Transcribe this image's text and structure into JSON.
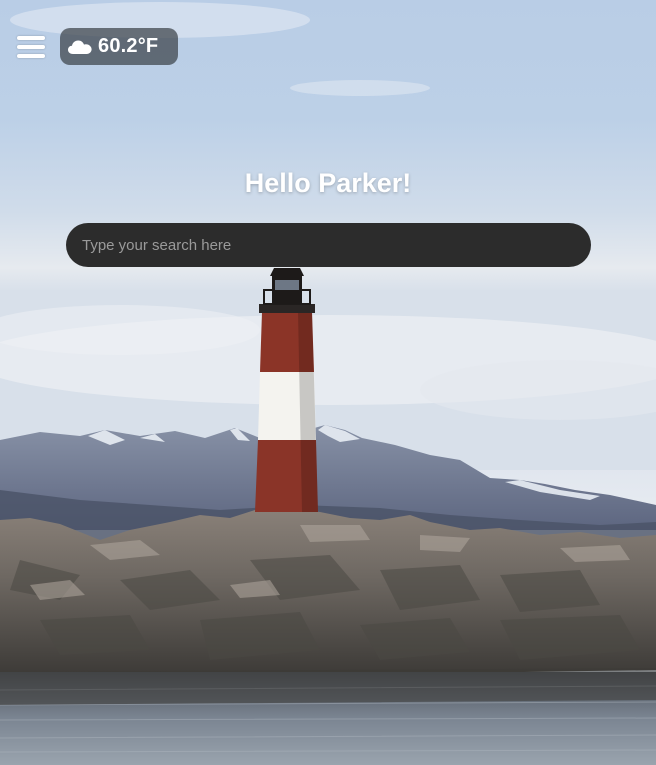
{
  "header": {
    "menu_icon": "hamburger-menu-icon",
    "weather": {
      "icon": "cloud-icon",
      "temperature": "60.2°F"
    }
  },
  "main": {
    "greeting": "Hello Parker!",
    "search": {
      "placeholder": "Type your search here",
      "value": ""
    }
  },
  "background": {
    "scene": "lighthouse-on-rocky-island-with-mountains"
  },
  "colors": {
    "search_bg": "#2c2c2c",
    "weather_pill_bg": "#3c424a",
    "text": "#ffffff"
  }
}
